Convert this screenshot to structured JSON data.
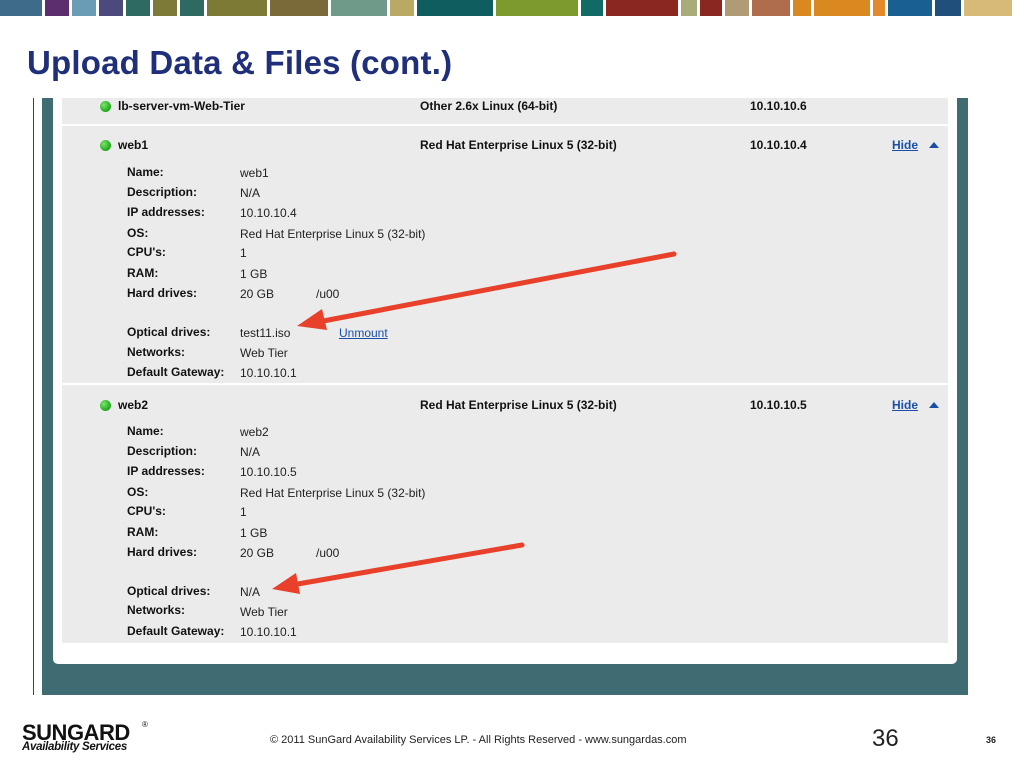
{
  "slide": {
    "title": "Upload Data & Files (cont.)",
    "stripe_colors": [
      "#3f6b8a",
      "#5d2e6e",
      "#6a9cb5",
      "#4c4a7c",
      "#2f6a62",
      "#7c7a36",
      "#2f6a62",
      "#7d7a35",
      "#7a6a3a",
      "#6f9a8a",
      "#b8a964",
      "#0f5d5e",
      "#7d9a2c",
      "#0f6b63",
      "#8a2721",
      "#a9ab7a",
      "#8a2721",
      "#b19a76",
      "#b06d4e",
      "#d9891f",
      "#d9891f",
      "#e4892a",
      "#1a5f92",
      "#1f4f7a",
      "#d7b978"
    ]
  },
  "vms": [
    {
      "name": "lb-server-vm-Web-Tier",
      "os": "Other 2.6x Linux (64-bit)",
      "ip": "10.10.10.6",
      "status_color": "#2cb52c"
    },
    {
      "name": "web1",
      "os": "Red Hat Enterprise Linux 5 (32-bit)",
      "ip": "10.10.10.4",
      "hide_label": "Hide",
      "status_color": "#2cb52c",
      "details": {
        "name_label": "Name:",
        "name_value": "web1",
        "description_label": "Description:",
        "description_value": "N/A",
        "ip_label": "IP addresses:",
        "ip_value": "10.10.10.4",
        "os_label": "OS:",
        "os_value": "Red Hat Enterprise Linux 5 (32-bit)",
        "cpu_label": "CPU's:",
        "cpu_value": "1",
        "ram_label": "RAM:",
        "ram_value": "1 GB",
        "hd_label": "Hard drives:",
        "hd_size": "20 GB",
        "hd_mount": "/u00",
        "optical_label": "Optical drives:",
        "optical_value": "test11.iso",
        "unmount_label": "Unmount",
        "networks_label": "Networks:",
        "networks_value": "Web Tier",
        "gateway_label": "Default Gateway:",
        "gateway_value": "10.10.10.1"
      }
    },
    {
      "name": "web2",
      "os": "Red Hat Enterprise Linux 5 (32-bit)",
      "ip": "10.10.10.5",
      "hide_label": "Hide",
      "status_color": "#2cb52c",
      "details": {
        "name_label": "Name:",
        "name_value": "web2",
        "description_label": "Description:",
        "description_value": "N/A",
        "ip_label": "IP addresses:",
        "ip_value": "10.10.10.5",
        "os_label": "OS:",
        "os_value": "Red Hat Enterprise Linux 5 (32-bit)",
        "cpu_label": "CPU's:",
        "cpu_value": "1",
        "ram_label": "RAM:",
        "ram_value": "1 GB",
        "hd_label": "Hard drives:",
        "hd_size": "20 GB",
        "hd_mount": "/u00",
        "optical_label": "Optical drives:",
        "optical_value": "N/A",
        "networks_label": "Networks:",
        "networks_value": "Web Tier",
        "gateway_label": "Default Gateway:",
        "gateway_value": "10.10.10.1"
      }
    }
  ],
  "annotation_arrow_color": "#e8402a",
  "footer": {
    "logo_brand": "SUNGARD",
    "logo_reg": "®",
    "logo_sub": "Availability Services",
    "copyright": "© 2011 SunGard Availability Services LP. - All Rights Reserved - www.sungardas.com",
    "page_big": "36",
    "page_small": "36"
  }
}
